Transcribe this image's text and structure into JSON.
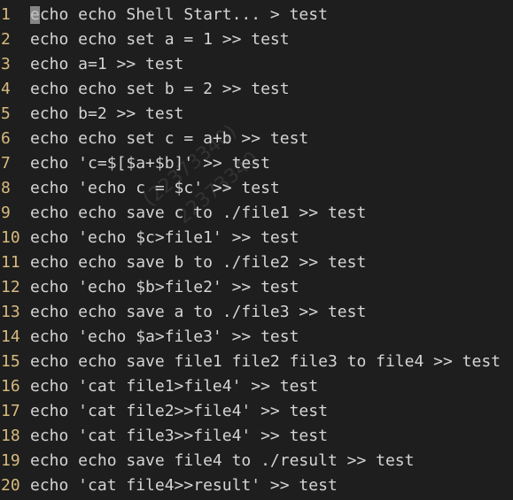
{
  "editor": {
    "lines": [
      {
        "num": "1",
        "text": "echo echo Shell Start... > test"
      },
      {
        "num": "2",
        "text": "echo echo set a = 1 >> test"
      },
      {
        "num": "3",
        "text": "echo a=1 >> test"
      },
      {
        "num": "4",
        "text": "echo echo set b = 2 >> test"
      },
      {
        "num": "5",
        "text": "echo b=2 >> test"
      },
      {
        "num": "6",
        "text": "echo echo set c = a+b >> test"
      },
      {
        "num": "7",
        "text": "echo 'c=$[$a+$b]' >> test"
      },
      {
        "num": "8",
        "text": "echo 'echo c = $c' >> test"
      },
      {
        "num": "9",
        "text": "echo echo save c to ./file1 >> test"
      },
      {
        "num": "10",
        "text": "echo 'echo $c>file1' >> test"
      },
      {
        "num": "11",
        "text": "echo echo save b to ./file2 >> test"
      },
      {
        "num": "12",
        "text": "echo 'echo $b>file2' >> test"
      },
      {
        "num": "13",
        "text": "echo echo save a to ./file3 >> test"
      },
      {
        "num": "14",
        "text": "echo 'echo $a>file3' >> test"
      },
      {
        "num": "15",
        "text": "echo echo save file1 file2 file3 to file4 >> test"
      },
      {
        "num": "16",
        "text": "echo 'cat file1>file4' >> test"
      },
      {
        "num": "17",
        "text": "echo 'cat file2>>file4' >> test"
      },
      {
        "num": "18",
        "text": "echo 'cat file3>>file4' >> test"
      },
      {
        "num": "19",
        "text": "echo echo save file4 to ./result >> test"
      },
      {
        "num": "20",
        "text": "echo 'cat file4>>result' >> test"
      }
    ]
  },
  "watermark": {
    "line1": "(22373340)",
    "line2": "22373340"
  },
  "colors": {
    "background": "#1e1e1e",
    "text": "#d4d4d4",
    "line_number": "#d7ba7d"
  }
}
